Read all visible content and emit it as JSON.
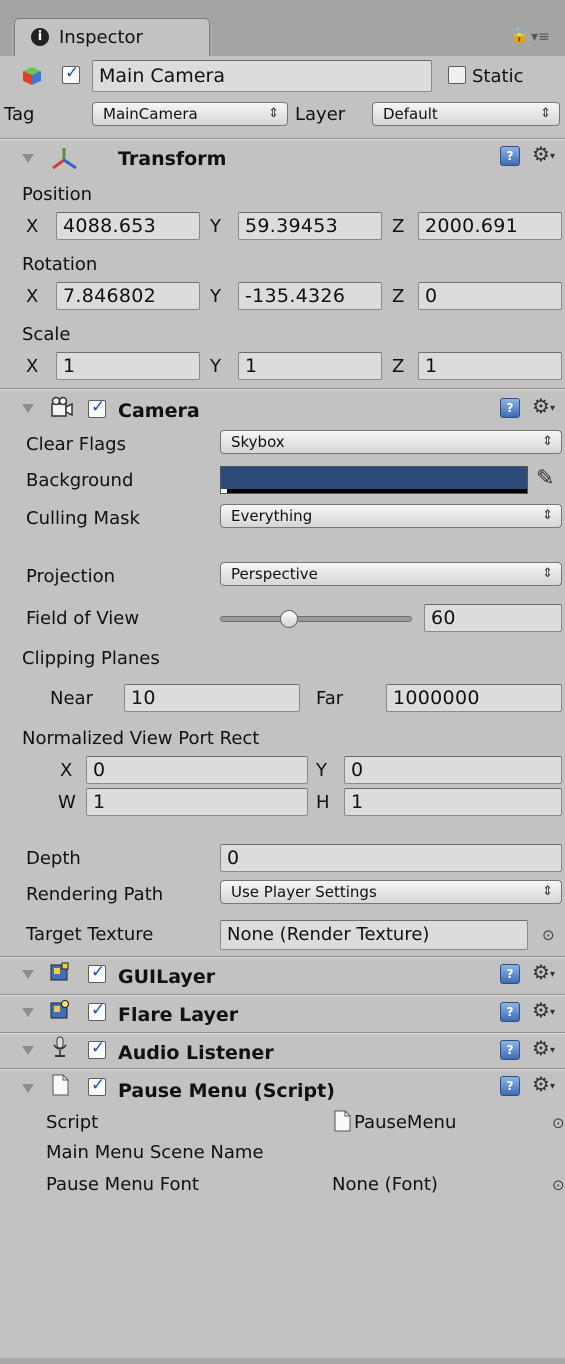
{
  "tab": {
    "title": "Inspector",
    "info_icon": "info-icon"
  },
  "header": {
    "name": "Main Camera",
    "active": true,
    "static_label": "Static",
    "static": false,
    "tag_label": "Tag",
    "tag_value": "MainCamera",
    "layer_label": "Layer",
    "layer_value": "Default"
  },
  "transform": {
    "title": "Transform",
    "position_label": "Position",
    "rotation_label": "Rotation",
    "scale_label": "Scale",
    "axis": {
      "x": "X",
      "y": "Y",
      "z": "Z"
    },
    "position": {
      "x": "4088.653",
      "y": "59.39453",
      "z": "2000.691"
    },
    "rotation": {
      "x": "7.846802",
      "y": "-135.4326",
      "z": "0"
    },
    "scale": {
      "x": "1",
      "y": "1",
      "z": "1"
    }
  },
  "camera": {
    "title": "Camera",
    "enabled": true,
    "clear_flags_label": "Clear Flags",
    "clear_flags": "Skybox",
    "background_label": "Background",
    "background_color": "#2c4a78",
    "culling_mask_label": "Culling Mask",
    "culling_mask": "Everything",
    "projection_label": "Projection",
    "projection": "Perspective",
    "fov_label": "Field of View",
    "fov": "60",
    "fov_slider_fraction": 0.36,
    "clipping_label": "Clipping Planes",
    "near_label": "Near",
    "near": "10",
    "far_label": "Far",
    "far": "1000000",
    "viewport_label": "Normalized View Port Rect",
    "vp": {
      "x_label": "X",
      "x": "0",
      "y_label": "Y",
      "y": "0",
      "w_label": "W",
      "w": "1",
      "h_label": "H",
      "h": "1"
    },
    "depth_label": "Depth",
    "depth": "0",
    "rendering_path_label": "Rendering Path",
    "rendering_path": "Use Player Settings",
    "target_texture_label": "Target Texture",
    "target_texture": "None (Render Texture)"
  },
  "components": [
    {
      "title": "GUILayer",
      "enabled": true
    },
    {
      "title": "Flare Layer",
      "enabled": true
    },
    {
      "title": "Audio Listener",
      "enabled": true
    }
  ],
  "script": {
    "title": "Pause Menu (Script)",
    "enabled": true,
    "script_label": "Script",
    "script_value": "PauseMenu",
    "scene_label": "Main Menu Scene Name",
    "font_label": "Pause Menu Font",
    "font_value": "None (Font)"
  },
  "colors": {
    "panel": "#c2c2c2",
    "help_blue": "#3d6db2",
    "checkbox_tick": "#1c52c4"
  }
}
